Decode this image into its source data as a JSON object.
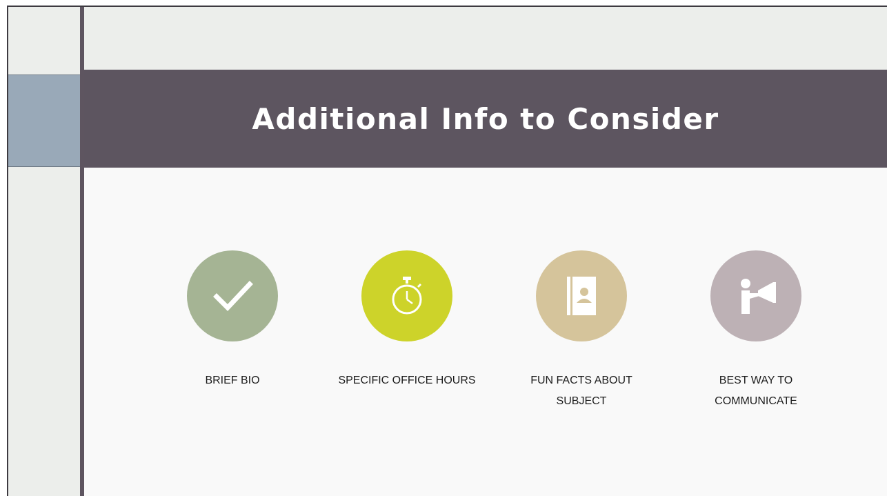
{
  "slide": {
    "title": "Additional Info to Consider",
    "items": [
      {
        "label": "BRIEF BIO",
        "icon": "checkmark-icon",
        "color": "#a5b494"
      },
      {
        "label": "SPECIFIC OFFICE HOURS",
        "icon": "stopwatch-icon",
        "color": "#cdd32a"
      },
      {
        "label": "FUN FACTS ABOUT SUBJECT",
        "icon": "address-book-icon",
        "color": "#d5c49b"
      },
      {
        "label": "BEST WAY TO COMMUNICATE",
        "icon": "megaphone-person-icon",
        "color": "#bdb1b5"
      }
    ]
  },
  "colors": {
    "title_band": "#5d5560",
    "accent_block": "#99a9b8",
    "vertical_bar": "#5e5560"
  }
}
